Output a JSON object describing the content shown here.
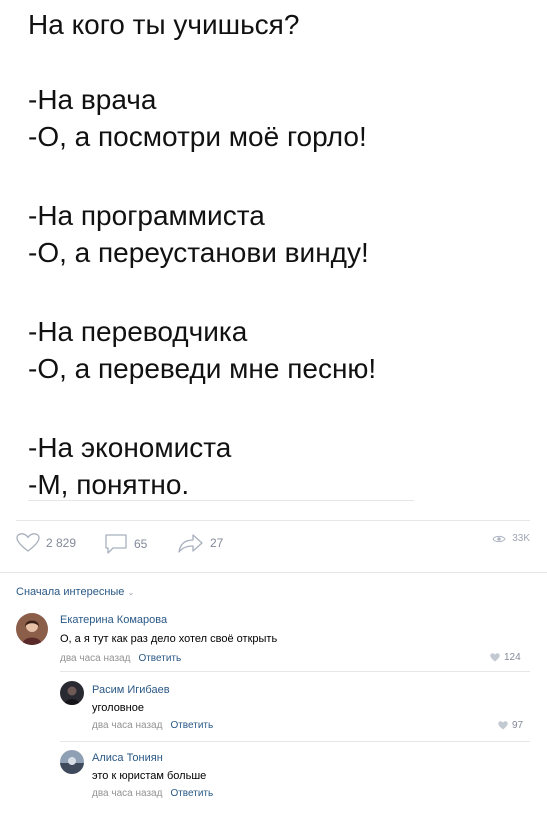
{
  "post": {
    "blocks": [
      [
        "На кого ты учишься?"
      ],
      [
        "-На врача",
        "-О, а посмотри моё горло!"
      ],
      [
        "-На программиста",
        "-О, а переустанови винду!"
      ],
      [
        "-На переводчика",
        "-О, а переведи мне песню!"
      ],
      [
        "-На экономиста",
        "-М, понятно."
      ]
    ]
  },
  "actions": {
    "likes": "2 829",
    "comments": "65",
    "shares": "27",
    "views": "33K"
  },
  "sort_label": "Сначала интересные",
  "comments": [
    {
      "author": "Екатерина Комарова",
      "text": "О, а я тут как раз дело хотел своё открыть",
      "time": "два часа назад",
      "reply": "Ответить",
      "likes": "124"
    },
    {
      "author": "Расим Игибаев",
      "text": "уголовное",
      "time": "два часа назад",
      "reply": "Ответить",
      "likes": "97"
    },
    {
      "author": "Алиса Тониян",
      "text": "это к юристам больше",
      "time": "два часа назад",
      "reply": "Ответить",
      "likes": ""
    }
  ],
  "colors": {
    "link": "#2a5885",
    "meta": "#939393",
    "icon": "#828a99"
  }
}
